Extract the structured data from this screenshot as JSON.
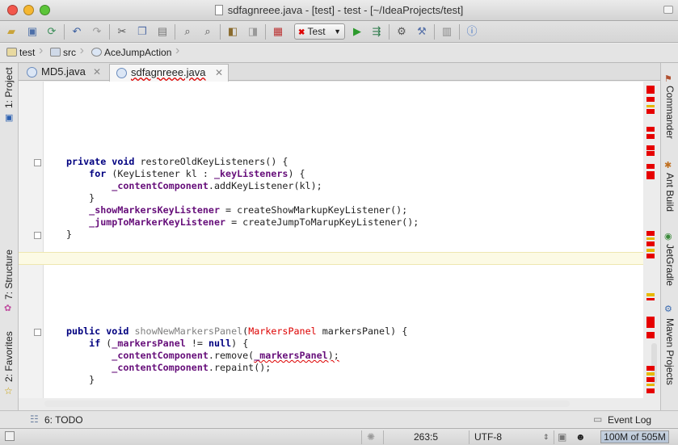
{
  "window": {
    "title": "sdfagnreee.java - [test] - test - [~/IdeaProjects/test]"
  },
  "toolbar": {
    "run_config": "Test"
  },
  "breadcrumbs": [
    "test",
    "src",
    "AceJumpAction"
  ],
  "tabs": [
    {
      "label": "MD5.java",
      "active": false
    },
    {
      "label": "sdfagnreee.java",
      "active": true
    }
  ],
  "left_tools": {
    "project": "1: Project",
    "structure": "7: Structure",
    "favorites": "2: Favorites"
  },
  "right_tools": {
    "commander": "Commander",
    "ant": "Ant Build",
    "jetgradle": "JetGradle",
    "maven": "Maven Projects"
  },
  "code": {
    "l1": {
      "kw": "private void ",
      "rest": "restoreOldKeyListeners() {"
    },
    "l2": {
      "kw": "for ",
      "a": "(KeyListener kl : ",
      "fld": "_keyListeners",
      "b": ") {"
    },
    "l3": {
      "fld": "_contentComponent",
      "rest": ".addKeyListener(kl);"
    },
    "l4": "}",
    "l5": {
      "fld": "_showMarkersKeyListener",
      "rest": " = createShowMarkupKeyListener();"
    },
    "l6": {
      "fld": "_jumpToMarkerKeyListener",
      "rest": " = createJumpToMarupKeyListener();"
    },
    "l7": "}",
    "l8": {
      "kw": "public void ",
      "gry": "showNewMarkersPanel",
      "p": "(",
      "red": "MarkersPanel",
      "rest": " markersPanel) {"
    },
    "l9": {
      "kw": "if ",
      "a": "(",
      "fld": "_markersPanel",
      "b": " != ",
      "kw2": "null",
      "c": ") {"
    },
    "l10": {
      "fld": "_contentComponent",
      "a": ".remove(",
      "fld2": "_markersPanel",
      "b": ");"
    },
    "l11": {
      "fld": "_contentComponent",
      "rest": ".repaint();"
    },
    "l12": "}"
  },
  "bottom_tools": {
    "todo": "6: TODO",
    "event_log": "Event Log"
  },
  "status": {
    "position": "263:5",
    "encoding": "UTF-8",
    "memory": "100M of 505M"
  },
  "colors": {
    "error": "#e60000",
    "warning": "#e6b800"
  }
}
